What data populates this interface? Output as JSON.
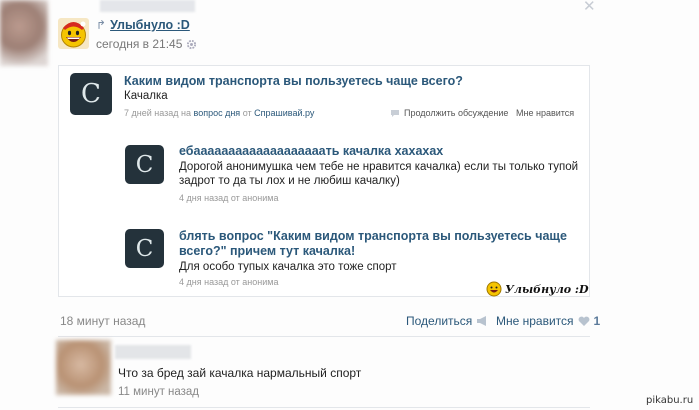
{
  "top_post": {
    "repost_symbol": "↱",
    "author": "Улыбнуло :D",
    "time": "сегодня в 21:45"
  },
  "question": {
    "title": "Каким видом транспорта вы пользуетесь чаще всего?",
    "answer": "Качалка",
    "meta_prefix": "7 дней назад на",
    "meta_link": "вопрос дня",
    "meta_mid": "от",
    "meta_source": "Спрашивай.ру",
    "discuss_label": "Продолжить обсуждение",
    "like_label": "Мне нравится"
  },
  "answers": [
    {
      "title": "ебааааааааааааааааааать качалка хахахах",
      "text_line1": "Дорогой анонимушка чем тебе не нравится качалка) если ты только тупой",
      "text_line2": "задрот то да ты лох и не любиш качалку)",
      "meta_time": "4 дня назад",
      "meta_from": "от анонима"
    },
    {
      "title_line1": "блять вопрос \"Каким видом транспорта вы пользуетесь чаще",
      "title_line2": "всего?\" причем тут качалка!",
      "text": "Для особо тупых качалка это тоже спорт",
      "meta_time": "4 дня назад",
      "meta_from": "от анонима"
    }
  ],
  "watermark": "Улыбнуло :D",
  "footer": {
    "ago": "18 минут назад",
    "share": "Поделиться",
    "like": "Мне нравится",
    "like_count": "1"
  },
  "comment": {
    "text": "Что за бред зай качалка нармальный спорт",
    "time": "11 минут назад"
  },
  "site_watermark": "pikabu.ru",
  "colors": {
    "link": "#2b587a",
    "icon_bg": "#24323b",
    "muted": "#888888"
  }
}
